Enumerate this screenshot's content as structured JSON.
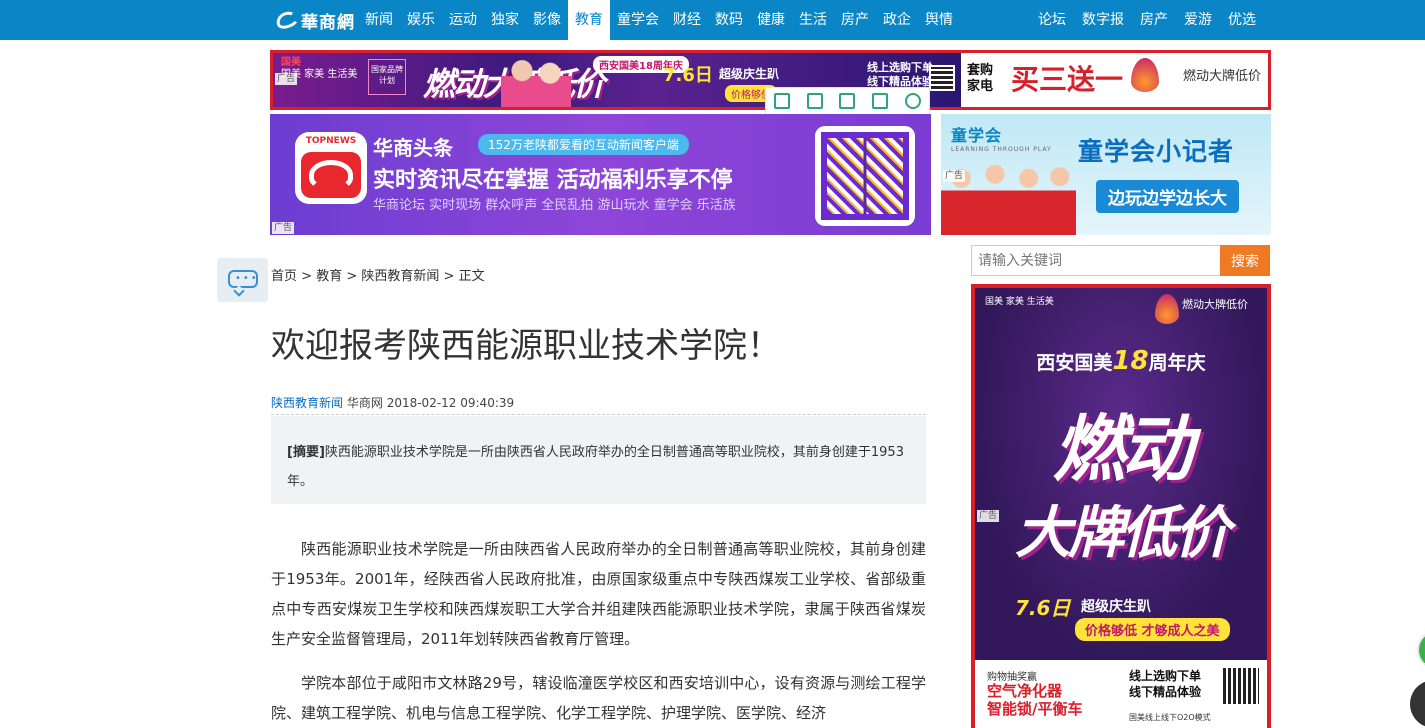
{
  "site": {
    "logo_text": "華商網"
  },
  "nav": {
    "items": [
      "新闻",
      "娱乐",
      "运动",
      "独家",
      "影像",
      "教育",
      "童学会",
      "财经",
      "数码",
      "健康",
      "生活",
      "房产",
      "政企",
      "舆情"
    ],
    "active_index": 5,
    "right_items": [
      "论坛",
      "数字报",
      "房产",
      "爱游",
      "优选"
    ]
  },
  "ads": {
    "label": "广告",
    "banner_top": {
      "brand_line1": "国美",
      "brand_line2": "国美 家美 生活美",
      "badge": "国家品牌计划",
      "headline": "燃动大牌低价",
      "pill": "西安国美18周年庆",
      "date": "7.6日",
      "date_tag": "超级庆生趴",
      "price_tag": "价格够低",
      "online_line1": "线上选购下单",
      "online_line2": "线下精品体验",
      "right_line1": "套购",
      "right_line2": "家电",
      "right_big": "买三送一",
      "right_tag": "燃动大牌低价"
    },
    "topnews": {
      "app_name": "TOPNEWS",
      "title": "华商头条",
      "pill": "152万老陕都爱看的互动新闻客户端",
      "slogan": "实时资讯尽在掌握 活动福利乐享不停",
      "tags": "华商论坛 实时现场 群众呼声 全民乱拍 游山玩水 童学会 乐活族"
    },
    "kids": {
      "logo": "童学会",
      "logo_sub": "LEARNING THROUGH PLAY",
      "headline": "童学会小记者",
      "sub": "边玩边学边长大"
    },
    "side": {
      "brand": "国美 家美 生活美",
      "brand_right": "燃动大牌低价",
      "anniv_prefix": "西安国美",
      "anniv_num": "18",
      "anniv_suffix": "周年庆",
      "ran": "燃动",
      "low": "大牌低价",
      "date": "7.6日",
      "date_tag": "超级庆生趴",
      "price": "价格够低 才够成人之美",
      "b1": "购物抽奖赢",
      "b2a": "空气净化器",
      "b2b": "智能锁/平衡车",
      "b3a": "线上选购下单",
      "b3b": "线下精品体验",
      "b4": "国美线上线下O2O模式"
    }
  },
  "breadcrumb": {
    "items": [
      "首页",
      "教育",
      "陕西教育新闻",
      "正文"
    ],
    "sep": " > "
  },
  "article": {
    "title": "欢迎报考陕西能源职业技术学院！",
    "source_link": "陕西教育新闻",
    "source": "华商网",
    "datetime": "2018-02-12 09:40:39",
    "summary_label": "[摘要]",
    "summary": "陕西能源职业技术学院是一所由陕西省人民政府举办的全日制普通高等职业院校，其前身创建于1953年。",
    "paragraphs": [
      "陕西能源职业技术学院是一所由陕西省人民政府举办的全日制普通高等职业院校，其前身创建于1953年。2001年，经陕西省人民政府批准，由原国家级重点中专陕西煤炭工业学校、省部级重点中专西安煤炭卫生学校和陕西煤炭职工大学合并组建陕西能源职业技术学院，隶属于陕西省煤炭生产安全监督管理局，2011年划转陕西省教育厅管理。",
      "学院本部位于咸阳市文林路29号，辖设临潼医学校区和西安培训中心，设有资源与测绘工程学院、建筑工程学院、机电与信息工程学院、化学工程学院、护理学院、医学院、经济"
    ]
  },
  "search": {
    "placeholder": "请输入关键词",
    "button": "搜索"
  }
}
